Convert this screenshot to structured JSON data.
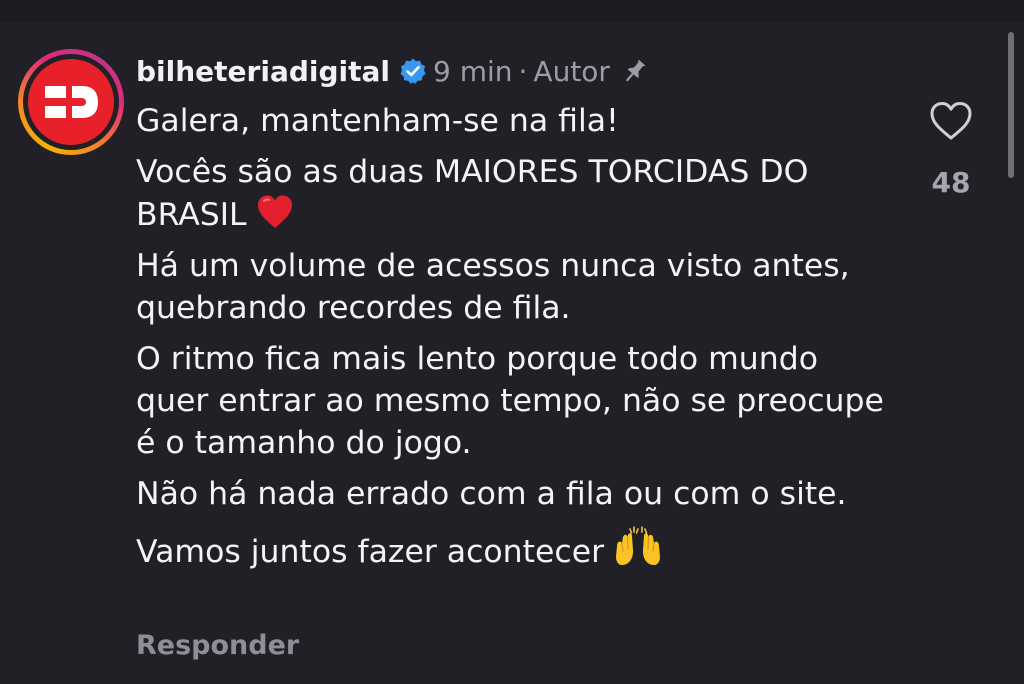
{
  "comment": {
    "username": "bilheteriadigital",
    "time": "9 min",
    "separator": "·",
    "author_label": "Autor",
    "paragraphs": [
      {
        "text": "Galera, mantenham-se na fila!"
      },
      {
        "text": "Vocês são as duas MAIORES TORCIDAS DO BRASIL",
        "emoji": "red-heart"
      },
      {
        "text": "Há um volume de acessos nunca visto antes, quebrando recordes de fila."
      },
      {
        "text": "O ritmo fica mais lento porque todo mundo quer entrar ao mesmo tempo, não se preocupe é o tamanho do jogo."
      },
      {
        "text": "Não há nada errado com a fila ou com o site."
      },
      {
        "text": "Vamos juntos fazer acontecer",
        "emoji": "raising-hands"
      }
    ],
    "like_count": "48",
    "reply_label": "Responder"
  },
  "icons": {
    "verified": "verified-badge-icon",
    "pin": "pin-icon",
    "like": "heart-outline-icon",
    "avatar_logo": "bilheteria-digital-logo"
  },
  "colors": {
    "background": "#202026",
    "text": "#f4f4f6",
    "muted": "#9b9ca4",
    "verified_blue": "#3897f0",
    "logo_red": "#e8202a"
  }
}
